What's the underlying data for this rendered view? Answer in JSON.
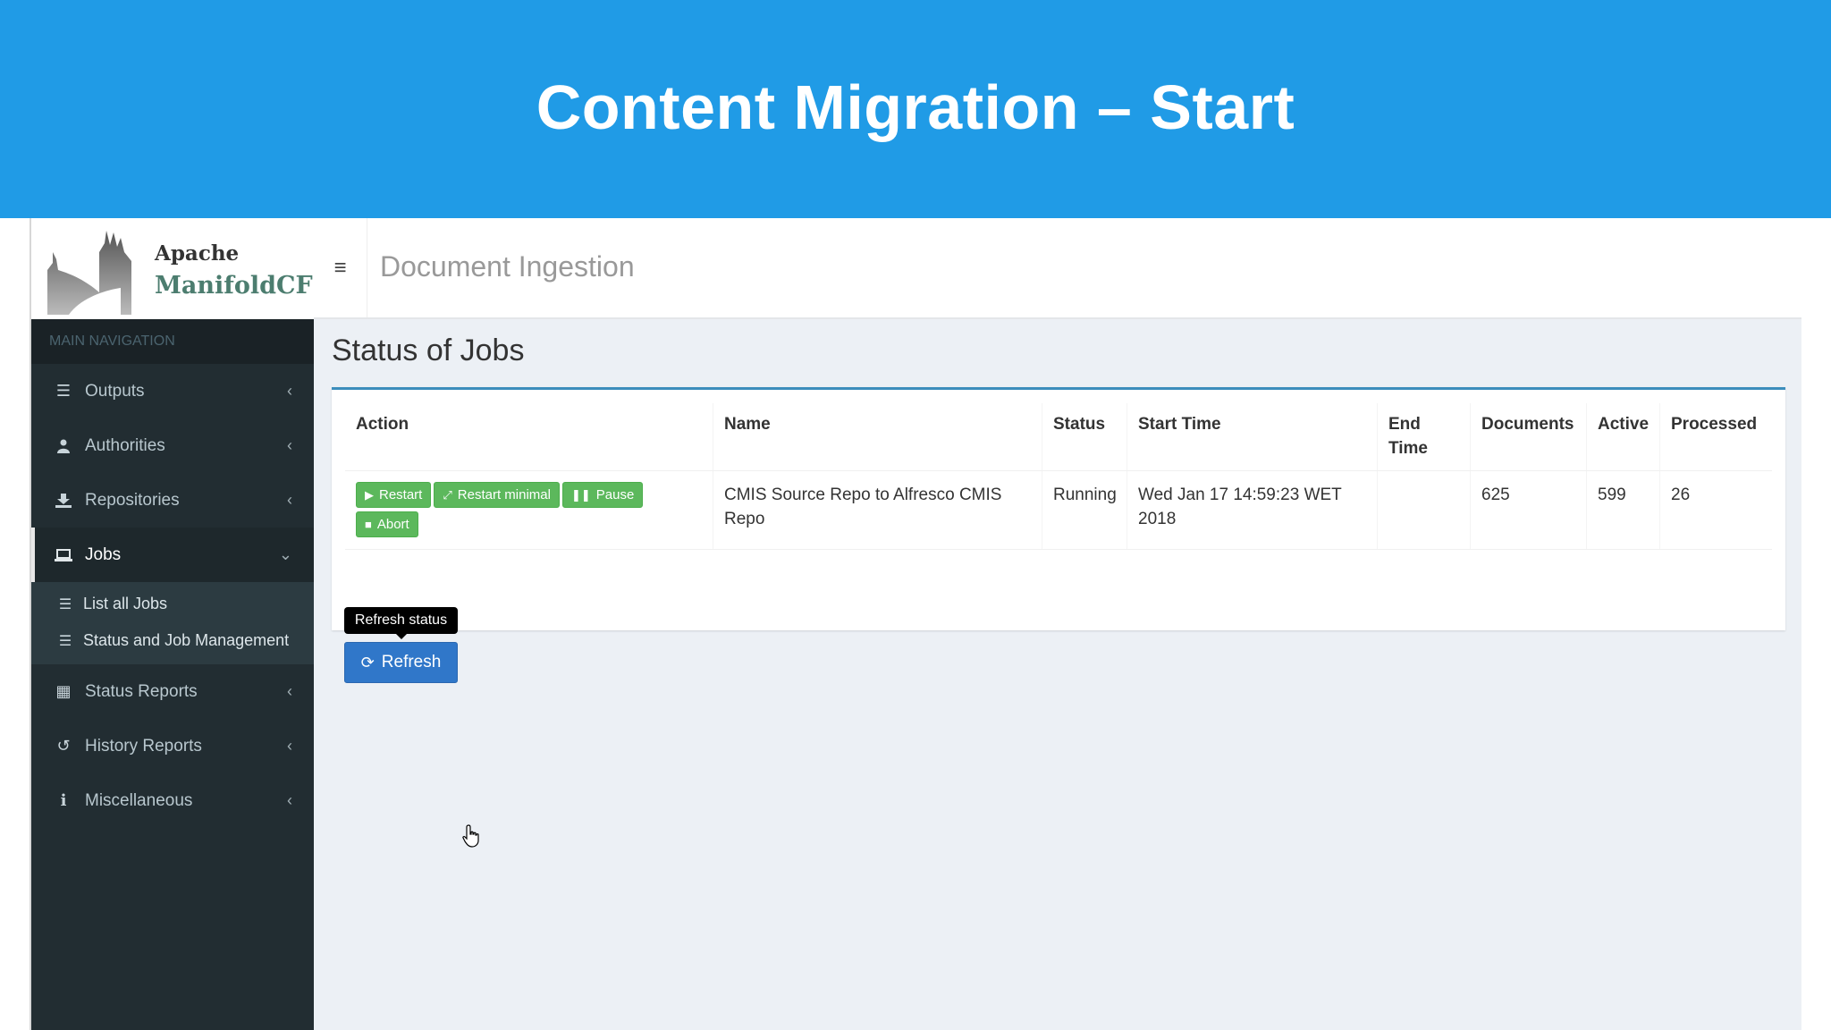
{
  "slide": {
    "title": "Content Migration – Start"
  },
  "logo": {
    "line1": "Apache",
    "line2": "ManifoldCF",
    "tm": "™"
  },
  "topbar": {
    "menu_icon": "hamburger-icon",
    "title": "Document Ingestion"
  },
  "sidebar": {
    "header": "MAIN NAVIGATION",
    "items": [
      {
        "label": "Outputs",
        "icon": "list-icon"
      },
      {
        "label": "Authorities",
        "icon": "user-icon"
      },
      {
        "label": "Repositories",
        "icon": "download-icon"
      },
      {
        "label": "Jobs",
        "icon": "laptop-icon"
      },
      {
        "label": "Status Reports",
        "icon": "table-icon"
      },
      {
        "label": "History Reports",
        "icon": "history-icon"
      },
      {
        "label": "Miscellaneous",
        "icon": "info-icon"
      }
    ],
    "jobs_subitems": [
      {
        "label": "List all Jobs",
        "icon": "list-icon"
      },
      {
        "label": "Status and Job Management",
        "icon": "list-icon"
      }
    ]
  },
  "main": {
    "title": "Status of Jobs",
    "table": {
      "headers": [
        "Action",
        "Name",
        "Status",
        "Start Time",
        "End Time",
        "Documents",
        "Active",
        "Processed"
      ],
      "rows": [
        {
          "name": "CMIS Source Repo to Alfresco CMIS Repo",
          "status": "Running",
          "start_time": "Wed Jan 17 14:59:23 WET 2018",
          "end_time": "",
          "documents": "625",
          "active": "599",
          "processed": "26",
          "actions": [
            "Restart",
            "Restart minimal",
            "Pause",
            "Abort"
          ]
        }
      ]
    },
    "tooltip": "Refresh status",
    "refresh_label": "Refresh"
  },
  "colors": {
    "banner": "#209be6",
    "sidebar": "#222d32",
    "accent": "#3c8dbc",
    "success": "#5cb85c",
    "primary": "#3077c9"
  }
}
